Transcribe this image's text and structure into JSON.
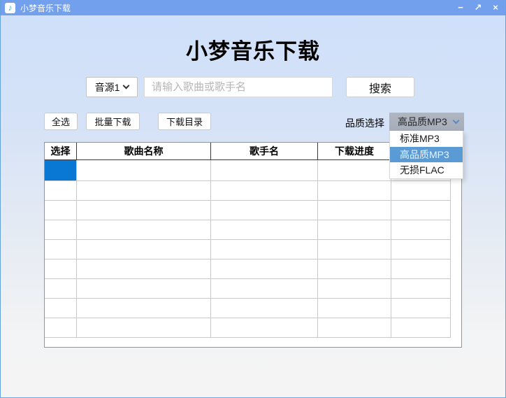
{
  "window": {
    "title": "小梦音乐下载",
    "app_icon_glyph": "♪",
    "controls": {
      "minimize": "−",
      "maximize": "↗",
      "close": "×"
    }
  },
  "header": {
    "title": "小梦音乐下载"
  },
  "search": {
    "source_selected": "音源1",
    "placeholder": "请输入歌曲或歌手名",
    "button_label": "搜索"
  },
  "toolbar": {
    "select_all_label": "全选",
    "batch_download_label": "批量下载",
    "download_dir_label": "下载目录",
    "quality_label": "品质选择",
    "quality_selected": "高品质MP3"
  },
  "quality_dropdown": {
    "options": [
      {
        "label": "标准MP3",
        "selected": false
      },
      {
        "label": "高品质MP3",
        "selected": true
      },
      {
        "label": "无损FLAC",
        "selected": false
      }
    ]
  },
  "table": {
    "columns": [
      {
        "label": "选择"
      },
      {
        "label": "歌曲名称"
      },
      {
        "label": "歌手名"
      },
      {
        "label": "下载进度"
      }
    ],
    "row_count": 9,
    "selection": {
      "row": 1,
      "column": 1
    }
  },
  "colors": {
    "titlebar": "#72a0ec",
    "selected_cell": "#0878d4",
    "dropdown_highlight": "#5b9bd5",
    "quality_select_bg": "#abb1bb",
    "window_border": "#65a2dd"
  }
}
